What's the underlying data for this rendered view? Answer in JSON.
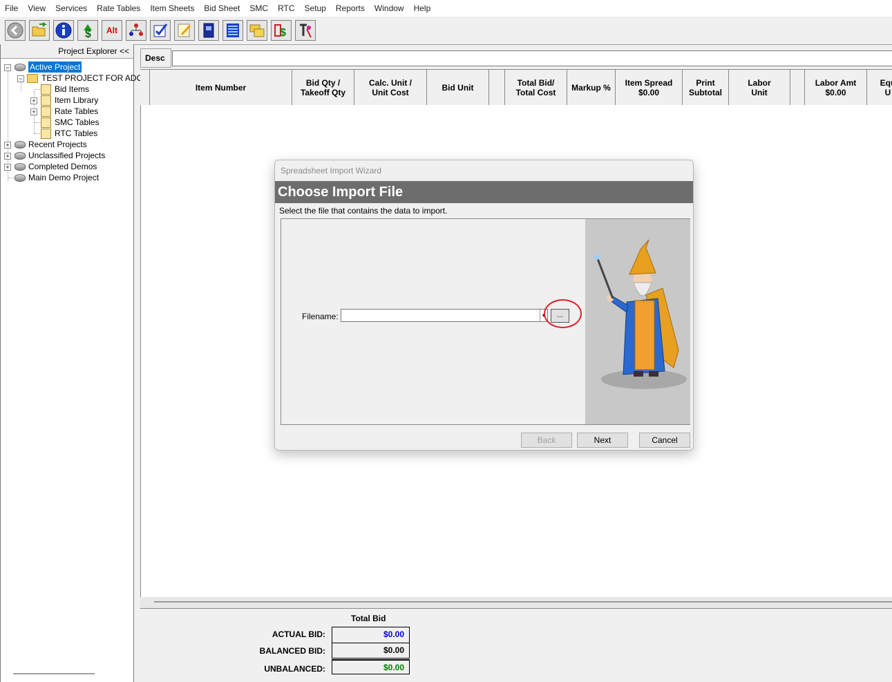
{
  "menu": [
    "File",
    "View",
    "Services",
    "Rate Tables",
    "Item Sheets",
    "Bid Sheet",
    "SMC",
    "RTC",
    "Setup",
    "Reports",
    "Window",
    "Help"
  ],
  "toolbar": {
    "icons": [
      "back-icon",
      "open-folder-icon",
      "info-icon",
      "bid-dollar-icon",
      "alt-icon",
      "org-chart-icon",
      "checklist-icon",
      "notepad-icon",
      "book-icon",
      "spreadsheet-icon",
      "folders-icon",
      "dollar-transfer-icon",
      "wizard-tool-icon"
    ],
    "alt_label": "Alt"
  },
  "explorer": {
    "header": "Project Explorer <<",
    "active_project": "Active Project",
    "project_name": "TEST PROJECT FOR ADO",
    "bid_items": "Bid Items",
    "item_library": "Item Library",
    "rate_tables": "Rate Tables",
    "smc_tables": "SMC Tables",
    "rtc_tables": "RTC Tables",
    "recent_projects": "Recent Projects",
    "unclassified_projects": "Unclassified Projects",
    "completed_demos": "Completed Demos",
    "main_demo_project": "Main Demo Project"
  },
  "desc_label": "Desc",
  "grid": {
    "columns": {
      "item_number": "Item Number",
      "bid_qty_1": "Bid Qty /",
      "bid_qty_2": "Takeoff Qty",
      "calc_unit_1": "Calc. Unit /",
      "calc_unit_2": "Unit Cost",
      "bid_unit": "Bid Unit",
      "total_bid_1": "Total Bid/",
      "total_bid_2": "Total Cost",
      "markup": "Markup %",
      "item_spread_1": "Item Spread",
      "item_spread_2": "$0.00",
      "print_subtotal_1": "Print",
      "print_subtotal_2": "Subtotal",
      "labor_unit_1": "Labor",
      "labor_unit_2": "Unit",
      "labor_amt_1": "Labor Amt",
      "labor_amt_2": "$0.00",
      "equip_1": "Equ",
      "equip_2": "U"
    }
  },
  "totals": {
    "header": "Total Bid",
    "actual_label": "ACTUAL BID:",
    "actual_value": "$0.00",
    "balanced_label": "BALANCED BID:",
    "balanced_value": "$0.00",
    "unbalanced_label": "UNBALANCED:",
    "unbalanced_value": "$0.00",
    "colors": {
      "actual": "#0000cc",
      "balanced": "#000000",
      "unbalanced": "#008000"
    }
  },
  "dialog": {
    "title": "Spreadsheet Import Wizard",
    "banner": "Choose Import File",
    "instruction": "Select the file that contains the data to import.",
    "filename_label": "Filename:",
    "filename_value": "",
    "browse_label": "...",
    "back_label": "Back",
    "next_label": "Next",
    "cancel_label": "Cancel",
    "image": "wizard-icon"
  }
}
